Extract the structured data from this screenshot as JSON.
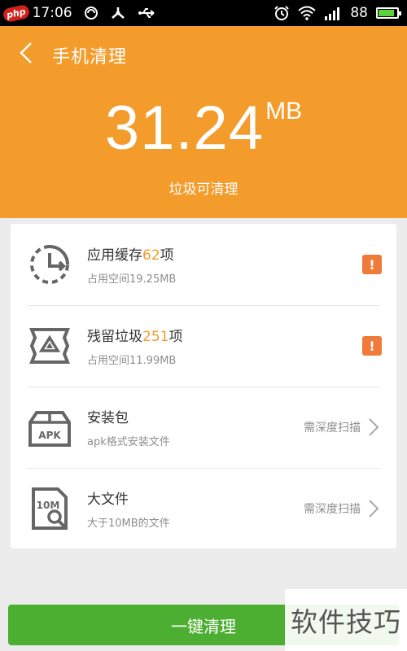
{
  "status_bar": {
    "logo_text": "php",
    "time": "17:06",
    "battery_level": "88",
    "battery_fill_percent": 85,
    "icons": [
      "notification-icon",
      "usb-debug-icon",
      "usb-icon",
      "alarm-icon",
      "wifi-icon",
      "signal-icon",
      "battery-icon"
    ]
  },
  "header": {
    "title": "手机清理",
    "junk_size": "31.24",
    "junk_unit": "MB",
    "subtitle": "垃圾可清理",
    "background_color": "#f39c2c"
  },
  "items": [
    {
      "title": "应用缓存",
      "count": "62",
      "count_suffix": "项",
      "subtitle": "占用空间19.25MB",
      "icon": "cache-clock-icon",
      "action": "warning"
    },
    {
      "title": "残留垃圾",
      "count": "251",
      "count_suffix": "项",
      "subtitle": "占用空间11.99MB",
      "icon": "residual-junk-icon",
      "action": "warning"
    },
    {
      "title": "安装包",
      "subtitle": "apk格式安装文件",
      "icon": "apk-box-icon",
      "icon_label": "APK",
      "action_text": "需深度扫描"
    },
    {
      "title": "大文件",
      "subtitle": "大于10MB的文件",
      "icon": "large-file-icon",
      "icon_label": "10M",
      "action_text": "需深度扫描"
    }
  ],
  "warning_symbol": "!",
  "clean_button": {
    "label": "一键清理",
    "color": "#4caf32"
  },
  "watermark": {
    "text": "软件技巧"
  }
}
